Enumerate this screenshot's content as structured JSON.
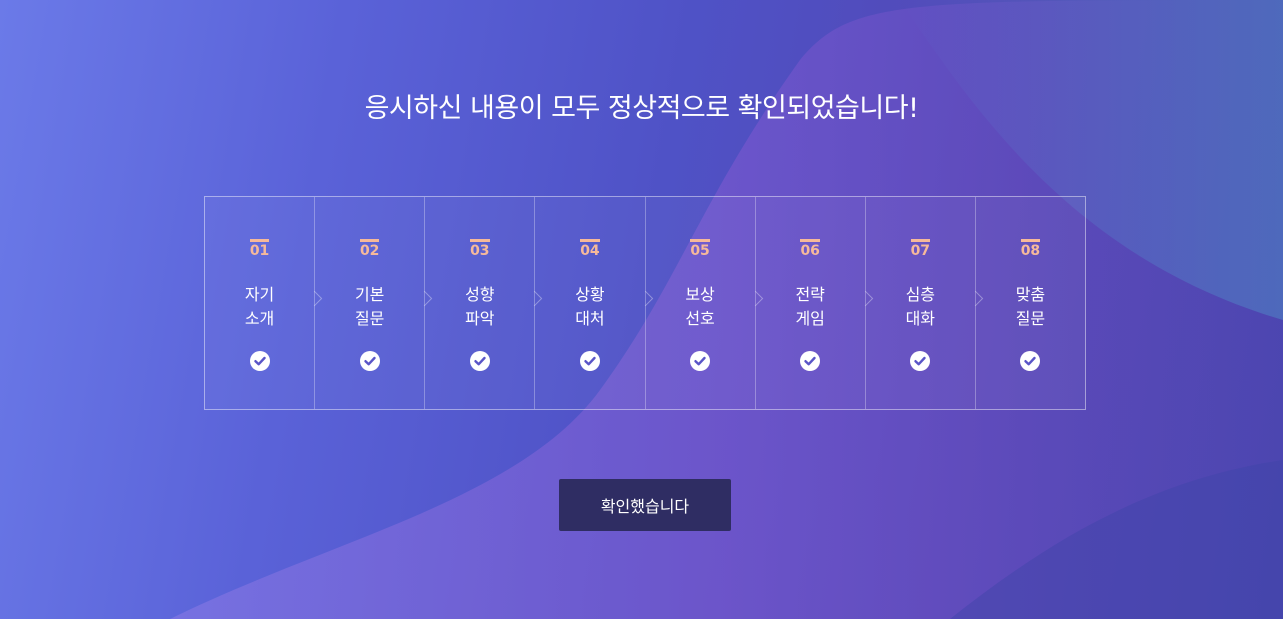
{
  "title": "응시하신 내용이 모두 정상적으로 확인되었습니다!",
  "steps": [
    {
      "number": "01",
      "label": "자기\n소개",
      "status": "check-circle-icon"
    },
    {
      "number": "02",
      "label": "기본\n질문",
      "status": "check-circle-icon"
    },
    {
      "number": "03",
      "label": "성향\n파악",
      "status": "check-circle-icon"
    },
    {
      "number": "04",
      "label": "상황\n대처",
      "status": "check-circle-icon"
    },
    {
      "number": "05",
      "label": "보상\n선호",
      "status": "check-circle-icon"
    },
    {
      "number": "06",
      "label": "전략\n게임",
      "status": "check-circle-icon"
    },
    {
      "number": "07",
      "label": "심층\n대화",
      "status": "check-circle-icon"
    },
    {
      "number": "08",
      "label": "맞춤\n질문",
      "status": "check-circle-icon"
    }
  ],
  "confirm_button": {
    "label": "확인했습니다"
  },
  "colors": {
    "accent_number": "#f6b99a",
    "button_bg": "#2f2d63",
    "text": "#ffffff"
  }
}
